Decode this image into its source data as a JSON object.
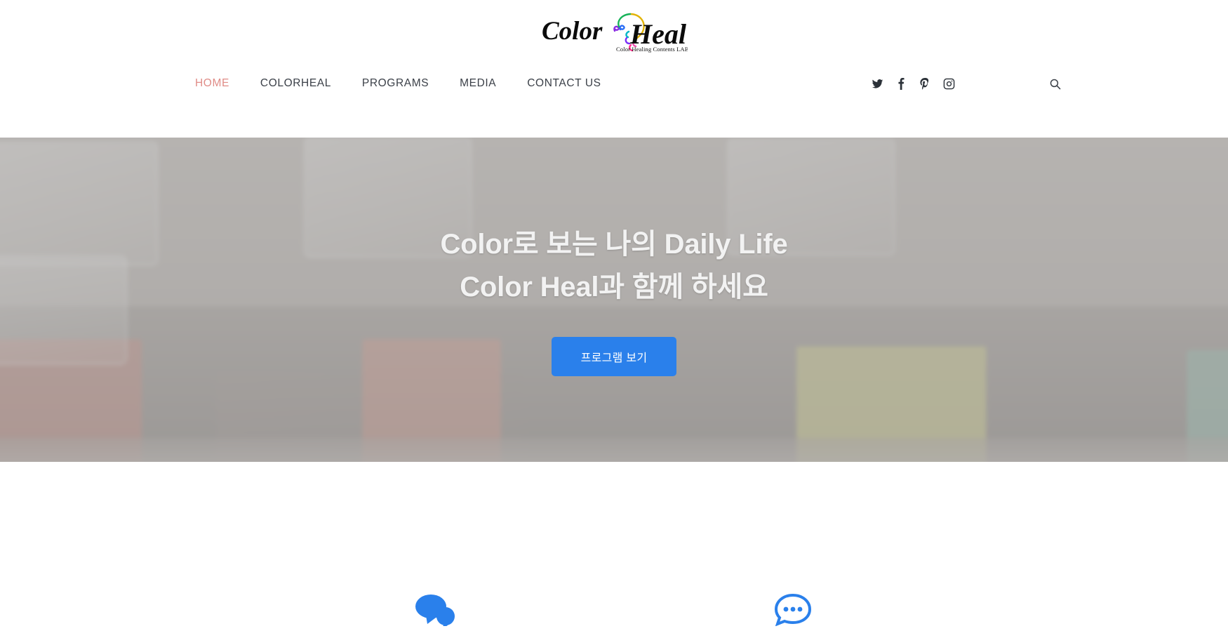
{
  "site": {
    "logo": {
      "word_one": "Color",
      "word_two": "Heal",
      "tagline": "Color Healing Contents LAB",
      "alt": "Color Heal - Color Healing Contents LAB"
    }
  },
  "nav": {
    "items": [
      {
        "label": "HOME",
        "active": true
      },
      {
        "label": "COLORHEAL",
        "active": false
      },
      {
        "label": "PROGRAMS",
        "active": false
      },
      {
        "label": "MEDIA",
        "active": false
      },
      {
        "label": "CONTACT US",
        "active": false
      }
    ],
    "active_color": "#e08c87",
    "inactive_color": "#3a3f47"
  },
  "social": {
    "items": [
      {
        "name": "twitter-icon",
        "label": "Twitter"
      },
      {
        "name": "facebook-icon",
        "label": "Facebook"
      },
      {
        "name": "pinterest-icon",
        "label": "Pinterest"
      },
      {
        "name": "instagram-icon",
        "label": "Instagram"
      }
    ]
  },
  "search": {
    "icon": "search-icon",
    "label": "Search"
  },
  "hero": {
    "title_line_1": "Color로 보는 나의 Daily Life",
    "title_line_2": "Color Heal과 함께 하세요",
    "cta_label": "프로그램 보기",
    "cta_color": "#2a80eb",
    "title_color": "#f2f2f2",
    "overlay_color": "rgba(168,166,164,0.62)",
    "background_description": "blurred photo of colored liquid-filled glass containers on a counter"
  },
  "features": {
    "items": [
      {
        "icon": "chat-bubbles-icon",
        "color": "#2a80eb"
      },
      {
        "icon": "chat-bubble-dots-icon",
        "color": "#2a80eb"
      }
    ]
  }
}
